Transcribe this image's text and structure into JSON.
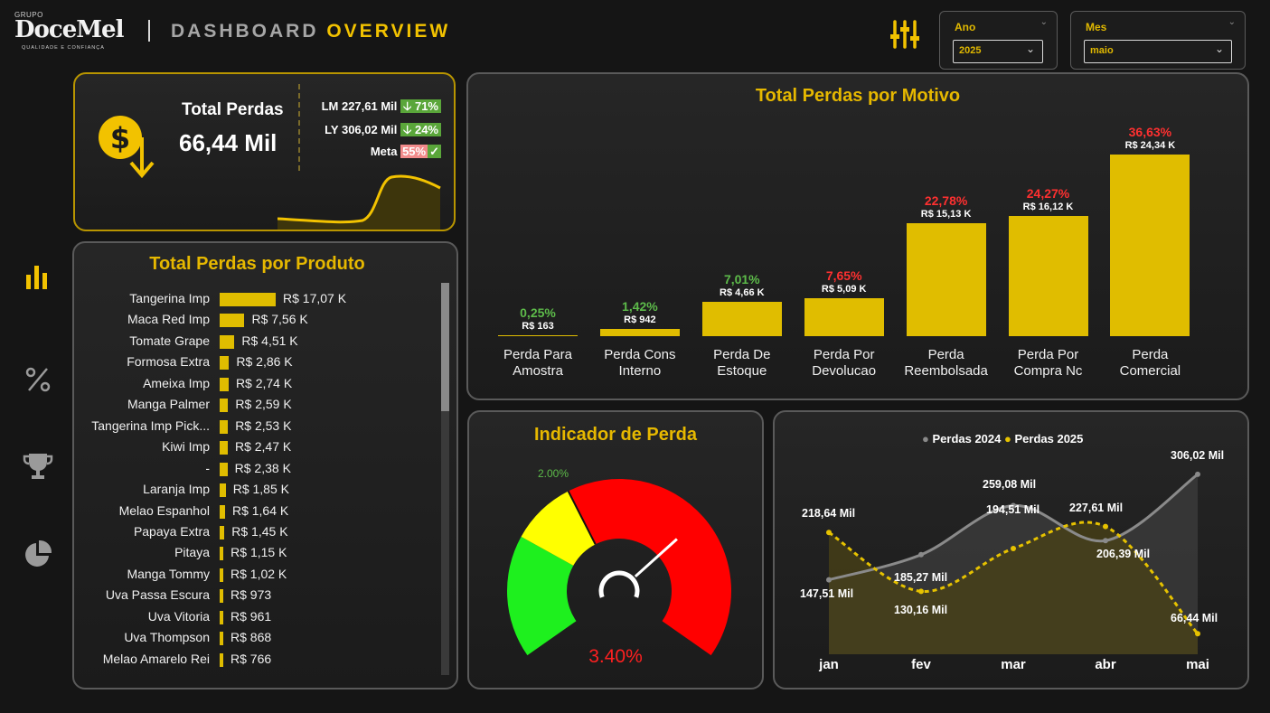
{
  "header": {
    "logo_grupo": "GRUPO",
    "logo_name": "DoceMel",
    "logo_sub": "QUALIDADE E CONFIANÇA",
    "title_part1": "DASHBOARD",
    "title_part2": "OVERVIEW",
    "filter_icon": "sliders-icon",
    "slicers": [
      {
        "label": "Ano",
        "value": "2025"
      },
      {
        "label": "Mes",
        "value": "maio"
      }
    ]
  },
  "nav": {
    "items": [
      {
        "icon": "bar-chart-icon",
        "active": true
      },
      {
        "icon": "percent-icon",
        "active": false
      },
      {
        "icon": "trophy-icon",
        "active": false
      },
      {
        "icon": "pie-chart-icon",
        "active": false
      }
    ]
  },
  "kpi": {
    "icon": "dollar-down-icon",
    "label": "Total Perdas",
    "value": "66,44 Mil",
    "lm_label": "LM 227,61 Mil",
    "lm_change": "🡣 71%",
    "ly_label": "LY 306,02 Mil",
    "ly_change": "🡣 24%",
    "meta_label": "Meta",
    "meta_value": "55%",
    "meta_icon": "✓"
  },
  "produto": {
    "title": "Total Perdas por Produto",
    "color": "#e0bd00",
    "items": [
      {
        "name": "Tangerina Imp",
        "value": 17.07,
        "label": "R$ 17,07 K"
      },
      {
        "name": "Maca Red Imp",
        "value": 7.56,
        "label": "R$ 7,56 K"
      },
      {
        "name": "Tomate Grape",
        "value": 4.51,
        "label": "R$ 4,51 K"
      },
      {
        "name": "Formosa Extra",
        "value": 2.86,
        "label": "R$ 2,86 K"
      },
      {
        "name": "Ameixa Imp",
        "value": 2.74,
        "label": "R$ 2,74 K"
      },
      {
        "name": "Manga Palmer",
        "value": 2.59,
        "label": "R$ 2,59 K"
      },
      {
        "name": "Tangerina Imp Pick...",
        "value": 2.53,
        "label": "R$ 2,53 K"
      },
      {
        "name": "Kiwi Imp",
        "value": 2.47,
        "label": "R$ 2,47 K"
      },
      {
        "name": "-",
        "value": 2.38,
        "label": "R$ 2,38 K"
      },
      {
        "name": "Laranja Imp",
        "value": 1.85,
        "label": "R$ 1,85 K"
      },
      {
        "name": "Melao Espanhol",
        "value": 1.64,
        "label": "R$ 1,64 K"
      },
      {
        "name": "Papaya Extra",
        "value": 1.45,
        "label": "R$ 1,45 K"
      },
      {
        "name": "Pitaya",
        "value": 1.15,
        "label": "R$ 1,15 K"
      },
      {
        "name": "Manga Tommy",
        "value": 1.02,
        "label": "R$ 1,02 K"
      },
      {
        "name": "Uva Passa Escura",
        "value": 0.973,
        "label": "R$ 973"
      },
      {
        "name": "Uva Vitoria",
        "value": 0.961,
        "label": "R$ 961"
      },
      {
        "name": "Uva Thompson",
        "value": 0.868,
        "label": "R$ 868"
      },
      {
        "name": "Melao Amarelo Rei",
        "value": 0.766,
        "label": "R$ 766"
      }
    ]
  },
  "motivo": {
    "title": "Total Perdas por Motivo",
    "bars": [
      {
        "line1": "Perda Para",
        "line2": "Amostra",
        "value": 0.163,
        "label": "R$ 163",
        "pct": "0,25%",
        "pct_color": "#5dbb4a"
      },
      {
        "line1": "Perda Cons",
        "line2": "Interno",
        "value": 0.942,
        "label": "R$ 942",
        "pct": "1,42%",
        "pct_color": "#5dbb4a"
      },
      {
        "line1": "Perda De",
        "line2": "Estoque",
        "value": 4.66,
        "label": "R$ 4,66 K",
        "pct": "7,01%",
        "pct_color": "#5dbb4a"
      },
      {
        "line1": "Perda Por",
        "line2": "Devolucao",
        "value": 5.09,
        "label": "R$ 5,09 K",
        "pct": "7,65%",
        "pct_color": "#ff3030"
      },
      {
        "line1": "Perda",
        "line2": "Reembolsada",
        "value": 15.13,
        "label": "R$ 15,13 K",
        "pct": "22,78%",
        "pct_color": "#ff3030"
      },
      {
        "line1": "Perda Por",
        "line2": "Compra Nc",
        "value": 16.12,
        "label": "R$ 16,12 K",
        "pct": "24,27%",
        "pct_color": "#ff3030"
      },
      {
        "line1": "Perda",
        "line2": "Comercial",
        "value": 24.34,
        "label": "R$ 24,34 K",
        "pct": "36,63%",
        "pct_color": "#ff3030"
      }
    ]
  },
  "gauge": {
    "title": "Indicador de Perda",
    "target_label": "2.00%",
    "value_label": "3.40%",
    "value": 3.4,
    "target": 2.0,
    "colors": {
      "green": "#1ef01e",
      "yellow": "#ffff00",
      "red": "#ff0000"
    }
  },
  "chart_data": {
    "type": "line",
    "categories": [
      "jan",
      "fev",
      "mar",
      "abr",
      "mai"
    ],
    "series": [
      {
        "name": "Perdas 2024",
        "color": "#8a8a8a",
        "values": [
          147.51,
          185.27,
          259.08,
          206.39,
          306.02
        ],
        "labels": [
          "147,51 Mil",
          "185,27 Mil",
          "259,08 Mil",
          "206,39 Mil",
          "306,02 Mil"
        ]
      },
      {
        "name": "Perdas 2025",
        "color": "#e6c200",
        "values": [
          218.64,
          130.16,
          194.51,
          227.61,
          66.44
        ],
        "labels": [
          "218,64 Mil",
          "130,16 Mil",
          "194,51 Mil",
          "227,61 Mil",
          "66,44 Mil"
        ]
      }
    ],
    "legend": "top-center"
  }
}
